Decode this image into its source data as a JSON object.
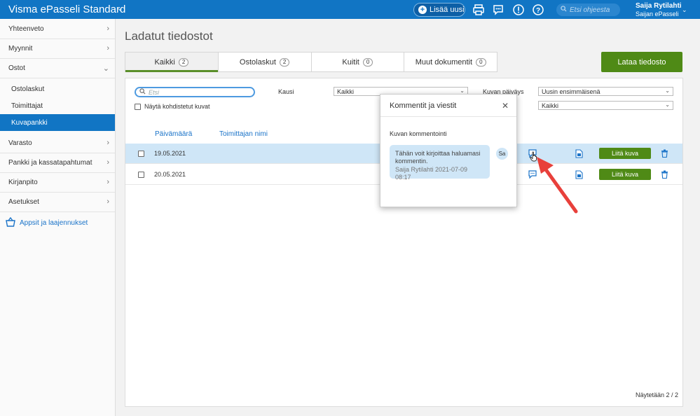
{
  "topbar": {
    "app_title": "Visma ePasseli Standard",
    "add_button": "Lisää uusi",
    "search_placeholder": "Etsi ohjeesta",
    "user_name": "Saija Rytilahti",
    "user_org": "Saijan ePasseli",
    "icons": [
      "printer-icon",
      "chat-icon",
      "alert-icon",
      "help-icon"
    ]
  },
  "sidebar": {
    "items": [
      {
        "label": "Yhteenveto"
      },
      {
        "label": "Myynnit"
      },
      {
        "label": "Ostot"
      }
    ],
    "sub_items": [
      {
        "label": "Ostolaskut"
      },
      {
        "label": "Toimittajat"
      },
      {
        "label": "Kuvapankki"
      }
    ],
    "items_after": [
      {
        "label": "Varasto"
      },
      {
        "label": "Pankki ja kassatapahtumat"
      },
      {
        "label": "Kirjanpito"
      },
      {
        "label": "Asetukset"
      }
    ],
    "apps_link": "Appsit ja laajennukset"
  },
  "main": {
    "title": "Ladatut tiedostot",
    "tabs": [
      {
        "label": "Kaikki",
        "count": "2"
      },
      {
        "label": "Ostolaskut",
        "count": "2"
      },
      {
        "label": "Kuitit",
        "count": "0"
      },
      {
        "label": "Muut dokumentit",
        "count": "0"
      }
    ],
    "upload_button": "Lataa tiedosto",
    "filters": {
      "search_placeholder": "Etsi",
      "show_targeted_label": "Näytä kohdistetut kuvat",
      "period_label": "Kausi",
      "period_value": "Kaikki",
      "image_date_label": "Kuvan päiväys",
      "image_date_value": "Uusin ensimmäisenä",
      "second_select_value": "Kaikki"
    },
    "columns": {
      "date": "Päivämäärä",
      "supplier": "Toimittajan nimi"
    },
    "rows": [
      {
        "date": "19.05.2021",
        "attach_label": "Liitä kuva"
      },
      {
        "date": "20.05.2021",
        "attach_label": "Liitä kuva"
      }
    ],
    "footer_count": "Näytetään 2 / 2"
  },
  "popup": {
    "title": "Kommentit ja viestit",
    "subtitle": "Kuvan kommentointi",
    "comment_text": "Tähän voit kirjoittaa haluamasi kommentin.",
    "comment_meta": "Saija Rytilahti 2021-07-09 08:17",
    "avatar_initials": "Sa"
  },
  "colors": {
    "brand_blue": "#1175c4",
    "primary_green": "#4f8a16",
    "annotation_arrow": "#e8403b"
  }
}
